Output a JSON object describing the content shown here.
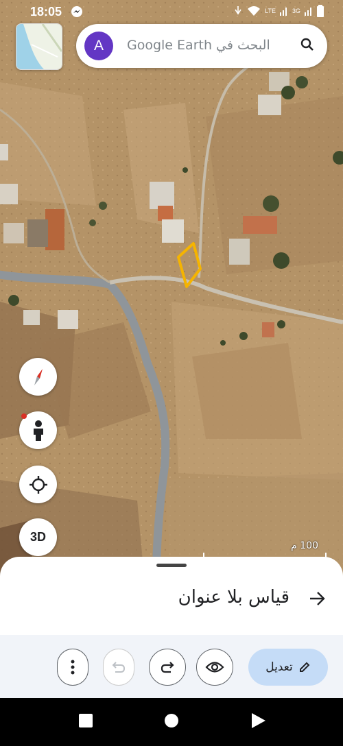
{
  "status_bar": {
    "time": "18:05",
    "network_lte": "LTE",
    "network_3g": "3G"
  },
  "search": {
    "avatar_letter": "A",
    "placeholder": "البحث في Google Earth"
  },
  "map_controls": {
    "three_d_label": "3D"
  },
  "scale_bar": {
    "label": "100 م"
  },
  "sheet": {
    "title": "قياس بلا عنوان",
    "edit_label": "تعديل"
  },
  "colors": {
    "accent": "#c5dcf7",
    "avatar": "#6336c4",
    "polygon": "#f5b400"
  }
}
